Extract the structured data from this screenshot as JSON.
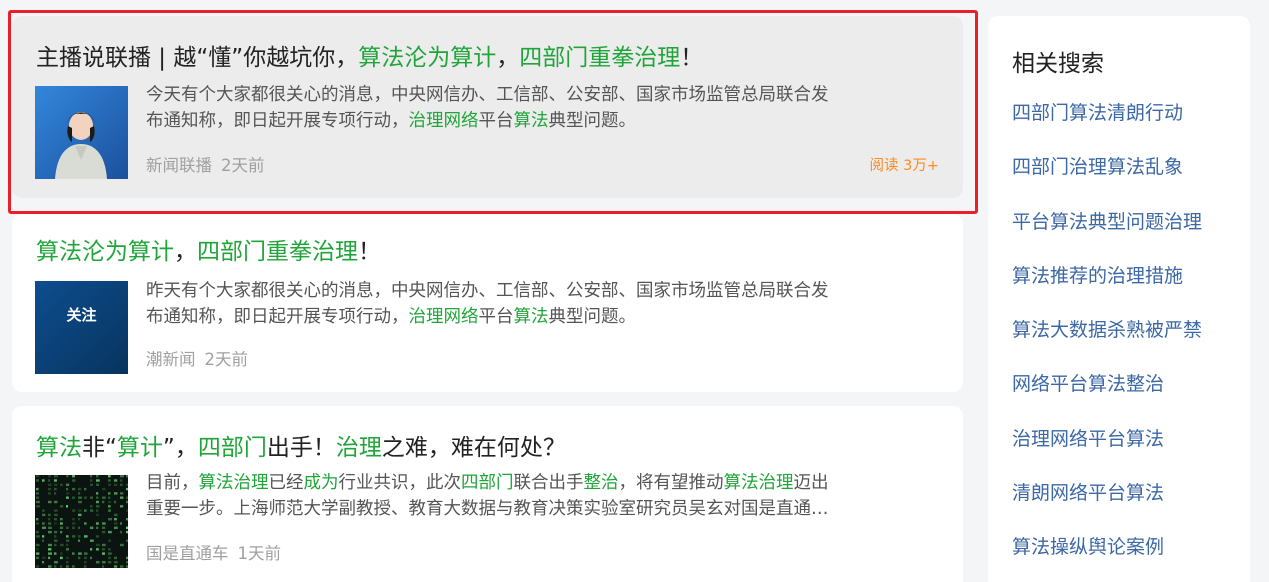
{
  "articles": [
    {
      "title_plain_1": "主播说联播 | 越“懂”你越坑你，",
      "title_green_1": "算法沦为算计",
      "title_plain_2": "，",
      "title_green_2": "四部门重拳治理",
      "title_plain_3": "！",
      "summary_line1": "今天有个大家都很关心的消息，中央网信办、工信部、公安部、国家市场监管总局联合发",
      "summary_line2_a": "布通知称，即日起开展专项行动，",
      "summary_line2_b": "治理网络",
      "summary_line2_c": "平台",
      "summary_line2_d": "算法",
      "summary_line2_e": "典型问题。",
      "source": "新闻联播",
      "time": "2天前",
      "reads": "阅读 3万+"
    },
    {
      "title_green_1": "算法沦为算计",
      "title_plain_1": "，",
      "title_green_2": "四部门重拳治理",
      "title_plain_2": "！",
      "thumb_text": "关注",
      "summary_line1": "昨天有个大家都很关心的消息，中央网信办、工信部、公安部、国家市场监管总局联合发",
      "summary_line2_a": "布通知称，即日起开展专项行动，",
      "summary_line2_b": "治理网络",
      "summary_line2_c": "平台",
      "summary_line2_d": "算法",
      "summary_line2_e": "典型问题。",
      "source": "潮新闻",
      "time": "2天前"
    },
    {
      "title_green_1": "算法",
      "title_plain_1": "非“",
      "title_green_2": "算计",
      "title_plain_2": "”，",
      "title_green_3": "四部门",
      "title_plain_3": "出手！",
      "title_green_4": "治理",
      "title_plain_4": "之难，难在何处？",
      "summary_l1_a": "目前，",
      "summary_l1_b": "算法治理",
      "summary_l1_c": "已经",
      "summary_l1_d": "成为",
      "summary_l1_e": "行业共识，此次",
      "summary_l1_f": "四部门",
      "summary_l1_g": "联合出手",
      "summary_l1_h": "整治",
      "summary_l1_i": "，将有望推动",
      "summary_l1_j": "算法治理",
      "summary_l1_k": "迈出",
      "summary_line2": "重要一步。上海师范大学副教授、教育大数据与教育决策实验室研究员吴玄对国是直通…",
      "source": "国是直通车",
      "time": "1天前"
    }
  ],
  "sidebar": {
    "title": "相关搜索",
    "items": [
      "四部门算法清朗行动",
      "四部门治理算法乱象",
      "平台算法典型问题治理",
      "算法推荐的治理措施",
      "算法大数据杀熟被严禁",
      "网络平台算法整治",
      "治理网络平台算法",
      "清朗网络平台算法",
      "算法操纵舆论案例"
    ]
  },
  "colors": {
    "highlight_green": "#20a53a",
    "link_blue": "#3c68a6",
    "reads_orange": "#ff8a1f",
    "selection_border": "#e8202a"
  },
  "icons": [
    "news-anchor-thumbnail",
    "follow-thumbnail",
    "matrix-code-thumbnail"
  ]
}
